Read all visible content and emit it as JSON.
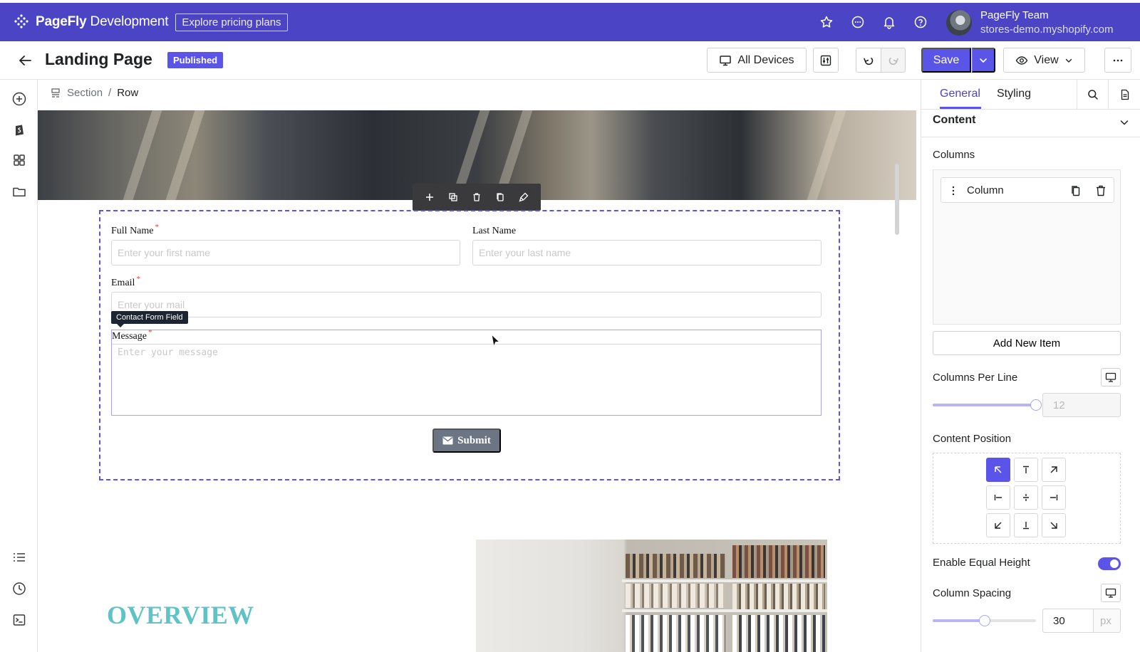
{
  "topbar": {
    "brand_bold": "PageFly",
    "brand_rest": " Development",
    "pricing_label": "Explore pricing plans",
    "team_name": "PageFly Team",
    "store_domain": "stores-demo.myshopify.com",
    "icons": [
      "star-icon",
      "chat-icon",
      "bell-icon",
      "help-icon"
    ]
  },
  "header": {
    "title": "Landing Page",
    "status_badge": "Published",
    "devices_label": "All Devices",
    "save_label": "Save",
    "view_label": "View"
  },
  "breadcrumb": {
    "items": [
      "Section",
      "Row"
    ],
    "separator": "/"
  },
  "form": {
    "first_name_label": "Full Name",
    "first_name_placeholder": "Enter your first name",
    "last_name_label": "Last Name",
    "last_name_placeholder": "Enter your last name",
    "email_label": "Email",
    "email_placeholder": "Enter your mail",
    "tooltip": "Contact Form Field",
    "message_label": "Message",
    "message_placeholder": "Enter your message",
    "submit_label": "Submit",
    "required_mark": "*"
  },
  "canvas": {
    "overview_heading": "OVERVIEW"
  },
  "panel": {
    "tabs": [
      "General",
      "Styling"
    ],
    "active_tab": "General",
    "section_title": "Content",
    "columns_label": "Columns",
    "column_item": "Column",
    "add_item_label": "Add New Item",
    "columns_per_line_label": "Columns Per Line",
    "columns_per_line_value": "12",
    "columns_per_line_fraction": 1.0,
    "content_position_label": "Content Position",
    "content_position_selected": "top-left",
    "equal_height_label": "Enable Equal Height",
    "equal_height_enabled": true,
    "column_spacing_label": "Column Spacing",
    "column_spacing_value": "30",
    "column_spacing_unit": "px",
    "column_spacing_fraction": 0.5
  },
  "colors": {
    "brand": "#4b45c6",
    "accent": "#5b54e8",
    "overview_heading": "#5ec2c6",
    "submit_bg": "#6b7583"
  }
}
